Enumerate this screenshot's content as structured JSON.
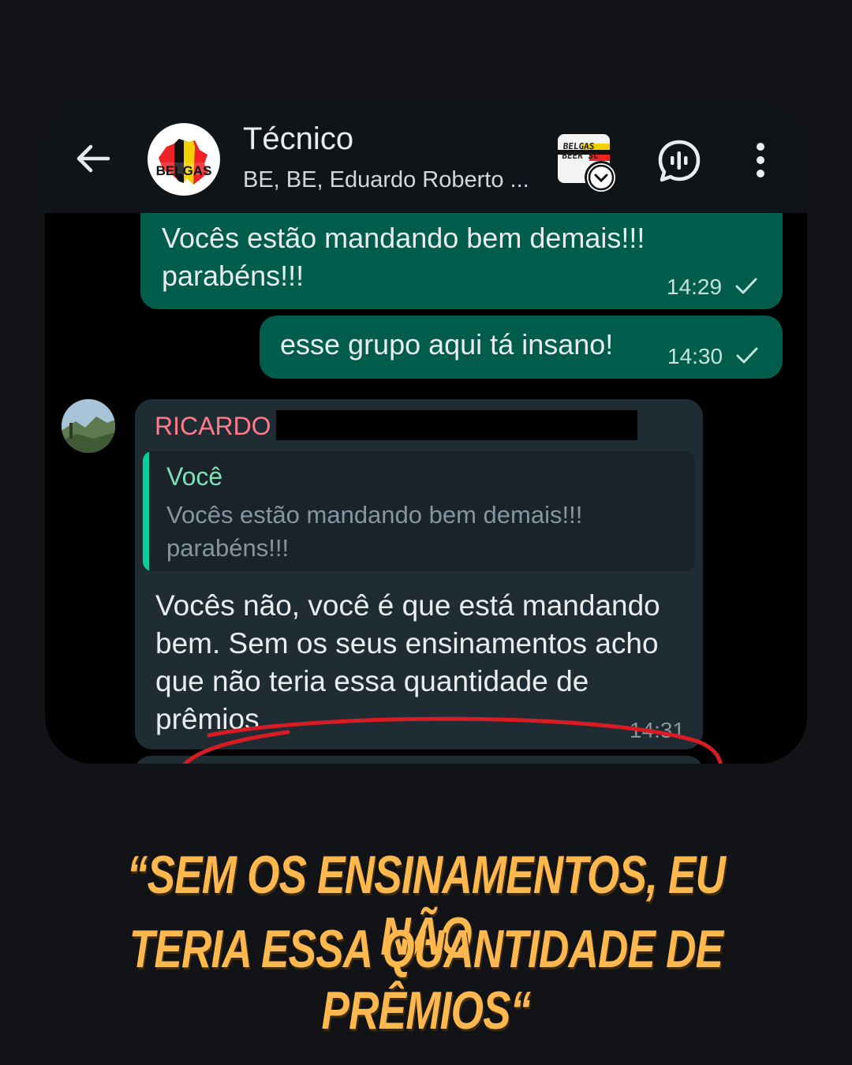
{
  "header": {
    "title": "Técnico",
    "subtitle": "BE, BE, Eduardo Roberto ...",
    "avatar_text": "BELGAS",
    "sticker_text_1": "BELGAS",
    "sticker_text_2": "BEER SC"
  },
  "messages": [
    {
      "direction": "out",
      "text": "Vocês estão mandando bem demais!!! parabéns!!!",
      "time": "14:29",
      "status": "sent"
    },
    {
      "direction": "out",
      "text": "esse grupo aqui tá insano!",
      "time": "14:30",
      "status": "sent"
    },
    {
      "direction": "in",
      "sender": "RICARDO",
      "quote": {
        "author": "Você",
        "text": "Vocês estão mandando bem demais!!! parabéns!!!"
      },
      "text": "Vocês não, você é que está mandando bem. Sem os seus ensinamentos acho que não teria essa quantidade de prêmios.",
      "time": "14:31"
    }
  ],
  "caption": {
    "line1": "“SEM OS ENSINAMENTOS, EU NÃO",
    "line2": "TERIA ESSA QUANTIDADE DE PRÊMIOS“"
  },
  "colors": {
    "background": "#111317",
    "header": "#0f1419",
    "outgoing_bubble": "#005c4b",
    "incoming_bubble": "#202c33",
    "sender_name": "#ff7b89",
    "quote_bar": "#06cf9c",
    "highlight": "#d91c24",
    "caption": "#ffb84d"
  }
}
